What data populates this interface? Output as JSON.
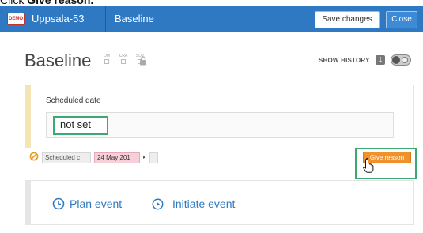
{
  "instruction": {
    "prefix": "Click ",
    "emphasis": "Give reason."
  },
  "topbar": {
    "demo_badge": "DEMO",
    "study_name": "Uppsala-53",
    "nav_item": "Baseline",
    "save_label": "Save changes",
    "close_label": "Close",
    "color": "#2f79c2"
  },
  "header": {
    "title": "Baseline",
    "flags": [
      {
        "label": "DM"
      },
      {
        "label": "CRA"
      },
      {
        "label": "SDV"
      }
    ],
    "lock_icon": "lock-icon",
    "show_history_label": "SHOW HISTORY",
    "history_count": "1"
  },
  "item": {
    "label": "Scheduled date",
    "value": "not set",
    "warning_icon": "no-entry-icon",
    "chips": {
      "scheduled": "Scheduled c",
      "date": "24 May 201",
      "arrow": "▸"
    },
    "give_reason_label": "Give reason",
    "accent_color": "#f0922b",
    "highlight_color": "#3ea872"
  },
  "events": {
    "plan_label": "Plan event",
    "initiate_label": "Initiate event",
    "plan_icon": "clock-icon",
    "initiate_icon": "play-circle-icon"
  }
}
